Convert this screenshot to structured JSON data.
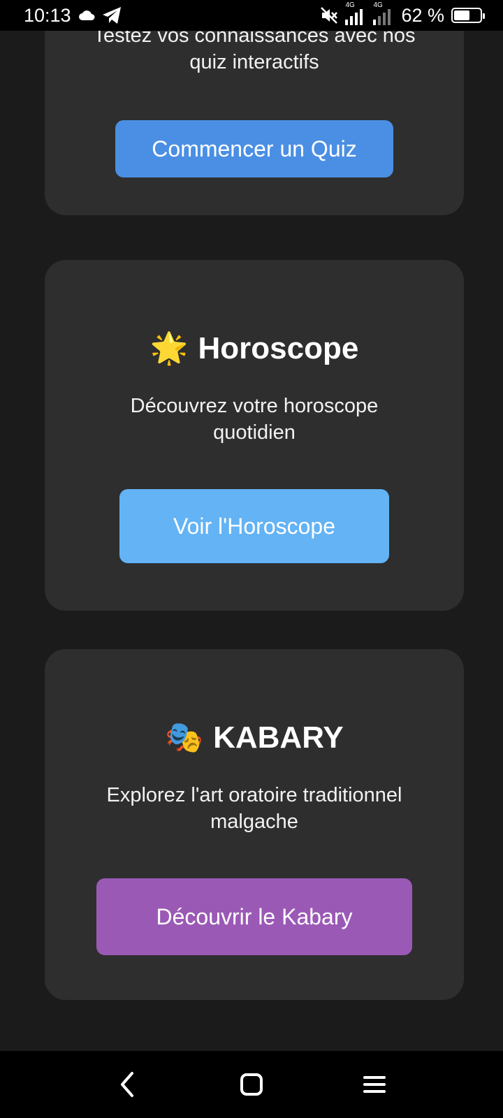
{
  "status_bar": {
    "time": "10:13",
    "net1": "4G",
    "net2": "4G",
    "battery_text": "62 %",
    "battery_level": 0.62,
    "icons": [
      "cloud-icon",
      "telegram-icon",
      "mute-icon",
      "signal-icon",
      "battery-icon"
    ]
  },
  "cards": {
    "quiz": {
      "description": "Testez vos connaissances avec nos quiz interactifs",
      "button": "Commencer un Quiz",
      "button_color": "#4a8fe4"
    },
    "horoscope": {
      "emoji": "🌟",
      "title": "Horoscope",
      "description": "Découvrez votre horoscope quotidien",
      "button": "Voir l'Horoscope",
      "button_color": "#63b3f5"
    },
    "kabary": {
      "emoji": "🎭",
      "title": "KABARY",
      "description": "Explorez l'art oratoire traditionnel malgache",
      "button": "Découvrir le Kabary",
      "button_color": "#9b59b6"
    }
  },
  "nav": {
    "icons": [
      "back-icon",
      "home-icon",
      "menu-icon"
    ]
  }
}
